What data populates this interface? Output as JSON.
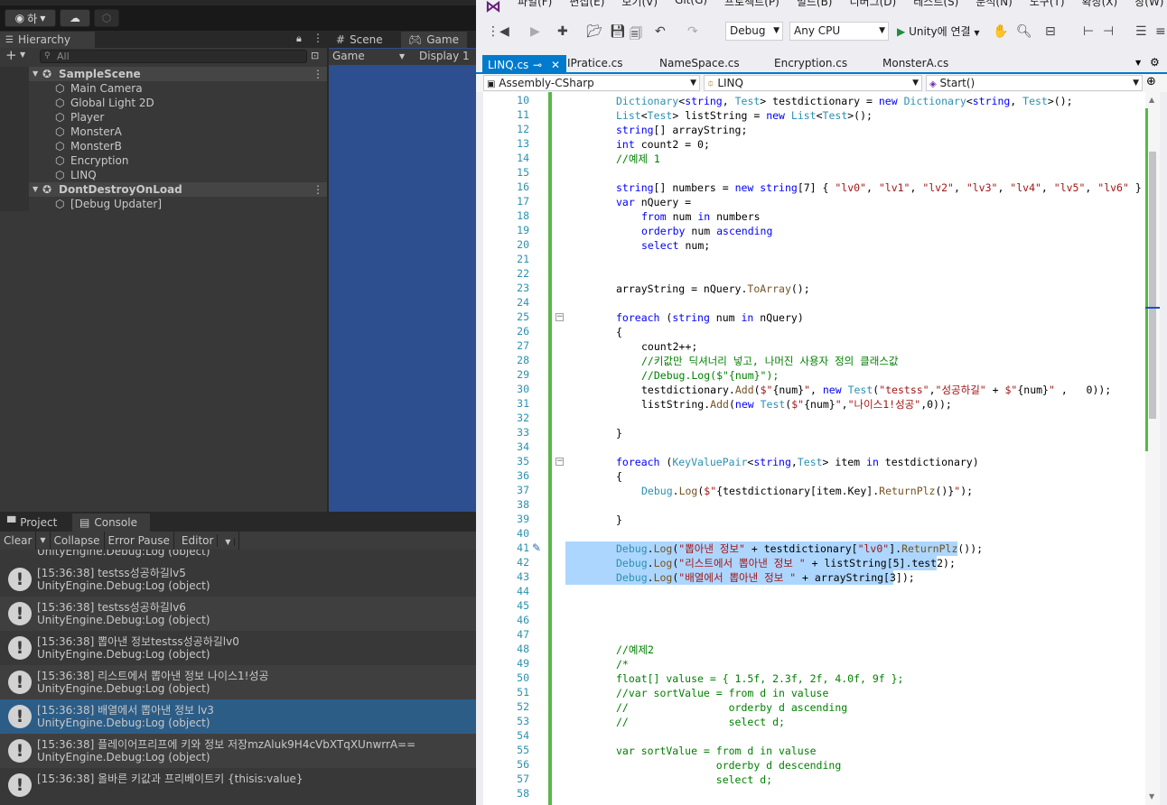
{
  "unity": {
    "toolbar": {
      "account_label": "하"
    },
    "hierarchy": {
      "tab": "Hierarchy",
      "search_placeholder": "All",
      "items": [
        {
          "label": "SampleScene",
          "level": 0,
          "scene": true
        },
        {
          "label": "Main Camera",
          "level": 1
        },
        {
          "label": "Global Light 2D",
          "level": 1
        },
        {
          "label": "Player",
          "level": 1
        },
        {
          "label": "MonsterA",
          "level": 1
        },
        {
          "label": "MonsterB",
          "level": 1
        },
        {
          "label": "Encryption",
          "level": 1
        },
        {
          "label": "LINQ",
          "level": 1
        },
        {
          "label": "DontDestroyOnLoad",
          "level": 0,
          "scene": true
        },
        {
          "label": "[Debug Updater]",
          "level": 1
        }
      ]
    },
    "scene_tab": "Scene",
    "game_tab": "Game",
    "game_bar": {
      "view": "Game",
      "display": "Display 1"
    },
    "console": {
      "project_tab": "Project",
      "console_tab": "Console",
      "toolbar": {
        "clear": "Clear",
        "collapse": "Collapse",
        "error_pause": "Error Pause",
        "editor": "Editor"
      },
      "partial_top": "UnityEngine.Debug:Log (object)",
      "entries": [
        {
          "line1": "[15:36:38] testss성공하길lv5",
          "line2": "UnityEngine.Debug:Log (object)"
        },
        {
          "line1": "[15:36:38] testss성공하길lv6",
          "line2": "UnityEngine.Debug:Log (object)"
        },
        {
          "line1": "[15:36:38] 뽑아낸 정보testss성공하길lv0",
          "line2": "UnityEngine.Debug:Log (object)"
        },
        {
          "line1": "[15:36:38] 리스트에서 뽑아낸 정보 나이스1!성공",
          "line2": "UnityEngine.Debug:Log (object)"
        },
        {
          "line1": "[15:36:38] 배열에서 뽑아낸 정보 lv3",
          "line2": "UnityEngine.Debug:Log (object)",
          "selected": true
        },
        {
          "line1": "[15:36:38] 플레이어프리프에 키와 정보 저장mzAluk9H4cVbXTqXUnwrrA==",
          "line2": "UnityEngine.Debug:Log (object)"
        },
        {
          "line1": "[15:36:38] 올바른 키값과 프리베이트키 {thisis:value}",
          "line2": ""
        }
      ]
    }
  },
  "vs": {
    "menu": [
      "파일(F)",
      "편집(E)",
      "보기(V)",
      "Git(G)",
      "프로젝트(P)",
      "빌드(B)",
      "디버그(D)",
      "테스트(S)",
      "분석(N)",
      "도구(T)",
      "확장(X)",
      "창(W)"
    ],
    "toolbar": {
      "config": "Debug",
      "platform": "Any CPU",
      "run": "Unity에 연결"
    },
    "tabs": [
      {
        "label": "LINQ.cs",
        "active": true
      },
      {
        "label": "IPratice.cs"
      },
      {
        "label": "NameSpace.cs"
      },
      {
        "label": "Encryption.cs"
      },
      {
        "label": "MonsterA.cs"
      }
    ],
    "nav": {
      "project": "Assembly-CSharp",
      "class": "LINQ",
      "member": "Start()"
    },
    "code": [
      {
        "n": "10",
        "i": 0,
        "tokens": [
          [
            "ty",
            "Dictionary"
          ],
          [
            "",
            "<"
          ],
          [
            "k",
            "string"
          ],
          [
            "",
            ", "
          ],
          [
            "ty",
            "Test"
          ],
          [
            "",
            "> testdictionary = "
          ],
          [
            "k",
            "new "
          ],
          [
            "ty",
            "Dictionary"
          ],
          [
            "",
            "<"
          ],
          [
            "k",
            "string"
          ],
          [
            "",
            ", "
          ],
          [
            "ty",
            "Test"
          ],
          [
            "",
            ">();"
          ]
        ]
      },
      {
        "n": "11",
        "i": 0,
        "tokens": [
          [
            "ty",
            "List"
          ],
          [
            "",
            "<"
          ],
          [
            "ty",
            "Test"
          ],
          [
            "",
            "> listString = "
          ],
          [
            "k",
            "new "
          ],
          [
            "ty",
            "List"
          ],
          [
            "",
            "<"
          ],
          [
            "ty",
            "Test"
          ],
          [
            "",
            ">();"
          ]
        ]
      },
      {
        "n": "12",
        "i": 0,
        "tokens": [
          [
            "k",
            "string"
          ],
          [
            "",
            "[] arrayString;"
          ]
        ]
      },
      {
        "n": "13",
        "i": 0,
        "tokens": [
          [
            "k",
            "int"
          ],
          [
            "",
            " count2 = 0;"
          ]
        ]
      },
      {
        "n": "14",
        "i": 0,
        "tokens": [
          [
            "c",
            "//예제 1"
          ]
        ]
      },
      {
        "n": "15",
        "i": 0,
        "tokens": []
      },
      {
        "n": "16",
        "i": 0,
        "tokens": [
          [
            "k",
            "string"
          ],
          [
            "",
            "[] numbers = "
          ],
          [
            "k",
            "new string"
          ],
          [
            "",
            "[7] { "
          ],
          [
            "s",
            "\"lv0\""
          ],
          [
            "",
            ", "
          ],
          [
            "s",
            "\"lv1\""
          ],
          [
            "",
            ", "
          ],
          [
            "s",
            "\"lv2\""
          ],
          [
            "",
            ", "
          ],
          [
            "s",
            "\"lv3\""
          ],
          [
            "",
            ", "
          ],
          [
            "s",
            "\"lv4\""
          ],
          [
            "",
            ", "
          ],
          [
            "s",
            "\"lv5\""
          ],
          [
            "",
            ", "
          ],
          [
            "s",
            "\"lv6\""
          ],
          [
            "",
            " }"
          ]
        ]
      },
      {
        "n": "17",
        "i": 0,
        "tokens": [
          [
            "k",
            "var"
          ],
          [
            "",
            " nQuery ="
          ]
        ]
      },
      {
        "n": "18",
        "i": 1,
        "tokens": [
          [
            "k",
            "from"
          ],
          [
            "",
            " num "
          ],
          [
            "k",
            "in"
          ],
          [
            "",
            " numbers"
          ]
        ]
      },
      {
        "n": "19",
        "i": 1,
        "tokens": [
          [
            "k",
            "orderby"
          ],
          [
            "",
            " num "
          ],
          [
            "k",
            "ascending"
          ]
        ]
      },
      {
        "n": "20",
        "i": 1,
        "tokens": [
          [
            "k",
            "select"
          ],
          [
            "",
            " num;"
          ]
        ]
      },
      {
        "n": "21",
        "i": 0,
        "tokens": []
      },
      {
        "n": "22",
        "i": 0,
        "tokens": []
      },
      {
        "n": "23",
        "i": 0,
        "tokens": [
          [
            "",
            "arrayString = nQuery."
          ],
          [
            "m",
            "ToArray"
          ],
          [
            "",
            "();"
          ]
        ]
      },
      {
        "n": "24",
        "i": 0,
        "tokens": []
      },
      {
        "n": "25",
        "i": 0,
        "fold": true,
        "tokens": [
          [
            "k",
            "foreach"
          ],
          [
            "",
            " ("
          ],
          [
            "k",
            "string"
          ],
          [
            "",
            " num "
          ],
          [
            "k",
            "in"
          ],
          [
            "",
            " nQuery)"
          ]
        ]
      },
      {
        "n": "26",
        "i": 0,
        "tokens": [
          [
            "",
            "{"
          ]
        ]
      },
      {
        "n": "27",
        "i": 1,
        "tokens": [
          [
            "",
            "count2++;"
          ]
        ]
      },
      {
        "n": "28",
        "i": 1,
        "tokens": [
          [
            "c",
            "//키값만 딕셔너리 넣고, 나머진 사용자 정의 클래스값"
          ]
        ]
      },
      {
        "n": "29",
        "i": 1,
        "tokens": [
          [
            "c",
            "//Debug.Log($\"{num}\");"
          ]
        ]
      },
      {
        "n": "30",
        "i": 1,
        "tokens": [
          [
            "",
            "testdictionary."
          ],
          [
            "m",
            "Add"
          ],
          [
            "",
            "("
          ],
          [
            "s",
            "$\""
          ],
          [
            "",
            "{num}"
          ],
          [
            "s",
            "\""
          ],
          [
            "",
            ", "
          ],
          [
            "k",
            "new "
          ],
          [
            "ty",
            "Test"
          ],
          [
            "",
            "("
          ],
          [
            "s",
            "\"testss\""
          ],
          [
            "",
            ","
          ],
          [
            "s",
            "\"성공하길\""
          ],
          [
            "",
            " + "
          ],
          [
            "s",
            "$\""
          ],
          [
            "",
            "{num}"
          ],
          [
            "s",
            "\""
          ],
          [
            "",
            " ,   0));"
          ]
        ]
      },
      {
        "n": "31",
        "i": 1,
        "tokens": [
          [
            "",
            "listString."
          ],
          [
            "m",
            "Add"
          ],
          [
            "",
            "("
          ],
          [
            "k",
            "new "
          ],
          [
            "ty",
            "Test"
          ],
          [
            "",
            "("
          ],
          [
            "s",
            "$\""
          ],
          [
            "",
            "{num}"
          ],
          [
            "s",
            "\""
          ],
          [
            "",
            ","
          ],
          [
            "s",
            "\"나이스1!성공\""
          ],
          [
            "",
            ",0));"
          ]
        ]
      },
      {
        "n": "32",
        "i": 0,
        "tokens": []
      },
      {
        "n": "33",
        "i": 0,
        "tokens": [
          [
            "",
            "}"
          ]
        ]
      },
      {
        "n": "34",
        "i": 0,
        "tokens": []
      },
      {
        "n": "35",
        "i": 0,
        "fold": true,
        "tokens": [
          [
            "k",
            "foreach"
          ],
          [
            "",
            " ("
          ],
          [
            "ty",
            "KeyValuePair"
          ],
          [
            "",
            "<"
          ],
          [
            "k",
            "string"
          ],
          [
            "",
            ","
          ],
          [
            "ty",
            "Test"
          ],
          [
            "",
            "> item "
          ],
          [
            "k",
            "in"
          ],
          [
            "",
            " testdictionary)"
          ]
        ]
      },
      {
        "n": "36",
        "i": 0,
        "tokens": [
          [
            "",
            "{"
          ]
        ]
      },
      {
        "n": "37",
        "i": 1,
        "tokens": [
          [
            "ty",
            "Debug"
          ],
          [
            "",
            "."
          ],
          [
            "m",
            "Log"
          ],
          [
            "",
            "("
          ],
          [
            "s",
            "$\""
          ],
          [
            "",
            "{testdictionary[item.Key]."
          ],
          [
            "m",
            "ReturnPlz"
          ],
          [
            "",
            "()}"
          ],
          [
            "s",
            "\""
          ],
          [
            "",
            ");"
          ]
        ]
      },
      {
        "n": "38",
        "i": 0,
        "tokens": []
      },
      {
        "n": "39",
        "i": 0,
        "tokens": [
          [
            "",
            "}"
          ]
        ]
      },
      {
        "n": "40",
        "i": 0,
        "tokens": []
      },
      {
        "n": "41",
        "i": 0,
        "sel": 434,
        "tokens": [
          [
            "ty",
            "Debug"
          ],
          [
            "",
            "."
          ],
          [
            "m",
            "Log"
          ],
          [
            "",
            "("
          ],
          [
            "s",
            "\"뽑아낸 정보\""
          ],
          [
            "",
            " + testdictionary["
          ],
          [
            "s",
            "\"lv0\""
          ],
          [
            "",
            "]."
          ],
          [
            "m",
            "ReturnPlz"
          ],
          [
            "",
            "());"
          ]
        ]
      },
      {
        "n": "42",
        "i": 0,
        "sel": 411,
        "tokens": [
          [
            "ty",
            "Debug"
          ],
          [
            "",
            "."
          ],
          [
            "m",
            "Log"
          ],
          [
            "",
            "("
          ],
          [
            "s",
            "\"리스트에서 뽑아낸 정보 \""
          ],
          [
            "",
            " + listString[5].test2);"
          ]
        ]
      },
      {
        "n": "43",
        "i": 0,
        "sel": 363,
        "tokens": [
          [
            "ty",
            "Debug"
          ],
          [
            "",
            "."
          ],
          [
            "m",
            "Log"
          ],
          [
            "",
            "("
          ],
          [
            "s",
            "\"배열에서 뽑아낸 정보 \""
          ],
          [
            "",
            " + arrayString[3]);"
          ]
        ]
      },
      {
        "n": "44",
        "i": 0,
        "tokens": []
      },
      {
        "n": "45",
        "i": 0,
        "tokens": []
      },
      {
        "n": "46",
        "i": 0,
        "tokens": []
      },
      {
        "n": "47",
        "i": 0,
        "tokens": []
      },
      {
        "n": "48",
        "i": 0,
        "tokens": [
          [
            "c",
            "//예제2"
          ]
        ]
      },
      {
        "n": "49",
        "i": 0,
        "tokens": [
          [
            "c",
            "/*"
          ]
        ]
      },
      {
        "n": "50",
        "i": 0,
        "tokens": [
          [
            "c",
            "float[] valuse = { 1.5f, 2.3f, 2f, 4.0f, 9f };"
          ]
        ]
      },
      {
        "n": "51",
        "i": 0,
        "tokens": [
          [
            "c",
            "//var sortValue = from d in valuse"
          ]
        ]
      },
      {
        "n": "52",
        "i": 0,
        "tokens": [
          [
            "c",
            "//                orderby d ascending"
          ]
        ]
      },
      {
        "n": "53",
        "i": 0,
        "tokens": [
          [
            "c",
            "//                select d;"
          ]
        ]
      },
      {
        "n": "54",
        "i": 0,
        "tokens": []
      },
      {
        "n": "55",
        "i": 0,
        "tokens": [
          [
            "c",
            "var sortValue = from d in valuse"
          ]
        ]
      },
      {
        "n": "56",
        "i": 0,
        "tokens": [
          [
            "c",
            "                orderby d descending"
          ]
        ]
      },
      {
        "n": "57",
        "i": 0,
        "tokens": [
          [
            "c",
            "                select d;"
          ]
        ]
      },
      {
        "n": "58",
        "i": 0,
        "tokens": []
      }
    ]
  }
}
